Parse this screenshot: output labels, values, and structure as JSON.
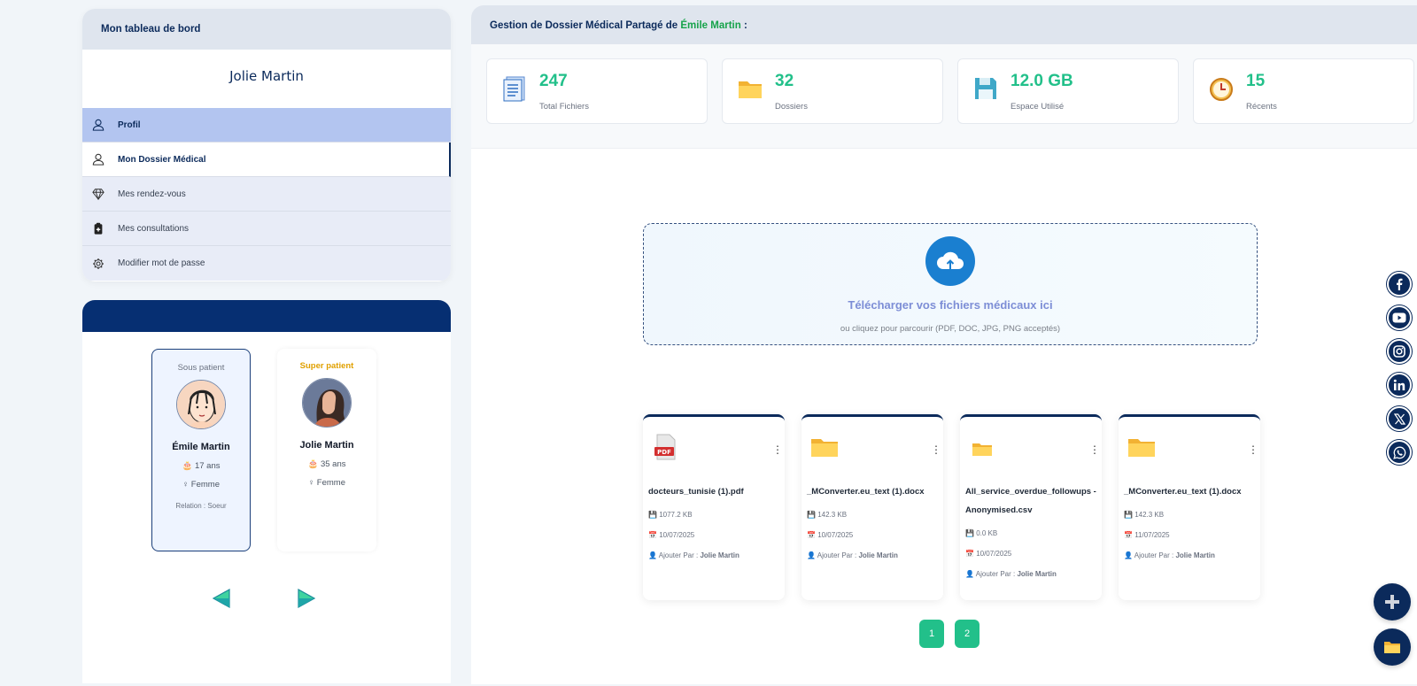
{
  "menu": {
    "title": "Mon tableau de bord",
    "user_name": "Jolie Martin",
    "items": [
      {
        "label": "Profil",
        "icon": "user-icon"
      },
      {
        "label": "Mon Dossier Médical",
        "icon": "user-icon"
      },
      {
        "label": "Mes rendez-vous",
        "icon": "diamond-icon"
      },
      {
        "label": "Mes consultations",
        "icon": "clipboard-icon"
      },
      {
        "label": "Modifier mot de passe",
        "icon": "gear-icon"
      }
    ]
  },
  "patients": [
    {
      "type": "Sous patient",
      "name": "Émile Martin",
      "age": "🎂 17 ans",
      "gender": "♀ Femme",
      "relation": "Relation : Soeur"
    },
    {
      "type": "Super patient",
      "name": "Jolie Martin",
      "age": "🎂 35 ans",
      "gender": "♀ Femme"
    }
  ],
  "main": {
    "title_prefix": "Gestion de Dossier Médical Partagé de ",
    "title_name": "Émile Martin",
    "title_suffix": " :"
  },
  "stats": [
    {
      "value": "247",
      "label": "Total Fichiers",
      "icon": "document-icon"
    },
    {
      "value": "32",
      "label": "Dossiers",
      "icon": "folder-icon"
    },
    {
      "value": "12.0 GB",
      "label": "Espace Utilisé",
      "icon": "floppy-icon"
    },
    {
      "value": "15",
      "label": "Récents",
      "icon": "clock-icon"
    }
  ],
  "upload": {
    "title": "Télécharger vos fichiers médicaux ici",
    "subtitle": "ou cliquez pour parcourir (PDF, DOC, JPG, PNG acceptés)"
  },
  "files": [
    {
      "name": "docteurs_tunisie (1).pdf",
      "size": "1077.2 KB",
      "date": "10/07/2025",
      "added_label": "Ajouter Par :",
      "added_by": "Jolie Martin",
      "icon": "pdf-icon"
    },
    {
      "name": "_MConverter.eu_text (1).docx",
      "size": "142.3 KB",
      "date": "10/07/2025",
      "added_label": "Ajouter Par :",
      "added_by": "Jolie Martin",
      "icon": "folder-icon"
    },
    {
      "name": "All_service_overdue_followups - Anonymised.csv",
      "size": "0.0 KB",
      "date": "10/07/2025",
      "added_label": "Ajouter Par :",
      "added_by": "Jolie Martin",
      "icon": "folder-small-icon"
    },
    {
      "name": "_MConverter.eu_text (1).docx",
      "size": "142.3 KB",
      "date": "11/07/2025",
      "added_label": "Ajouter Par :",
      "added_by": "Jolie Martin",
      "icon": "folder-icon"
    }
  ],
  "pagination": [
    "1",
    "2"
  ],
  "social": [
    "facebook-icon",
    "youtube-icon",
    "instagram-icon",
    "linkedin-icon",
    "x-icon",
    "whatsapp-icon"
  ],
  "colors": {
    "accent": "#22c08a",
    "navy": "#0b2a5b",
    "highlight": "#16a34a"
  }
}
